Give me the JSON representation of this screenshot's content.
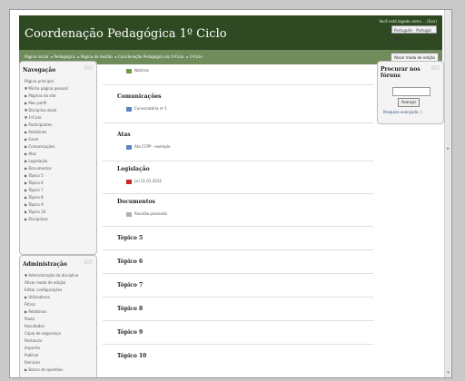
{
  "header": {
    "title": "Coordenação Pedagógica 1º Ciclo",
    "login_text": "Você está logado como ... (Sair)",
    "language": "Português - Portugal (pt)"
  },
  "navbar": {
    "breadcrumbs": [
      "Página inicial",
      "Pedagógica",
      "Página da Gestão",
      "Coordenação Pedagógica do 1ºCiclo",
      "1ºCiclo"
    ],
    "edit_button": "Ativar modo de edição"
  },
  "navigation": {
    "title": "Navegação",
    "items": [
      "Página principal",
      "▼ Minha página pessoal",
      "▶ Páginas do site",
      "▶ Meu perfil",
      "▼ Disciplina atual",
      "  ▼ 1ºCiclo",
      "    ▶ Participantes",
      "    ▶ Relatórios",
      "    ▶ Geral",
      "    ▶ Comunicações",
      "    ▶ Atas",
      "    ▶ Legislação",
      "    ▶ Documentos",
      "    ▶ Tópico 5",
      "    ▶ Tópico 6",
      "    ▶ Tópico 7",
      "    ▶ Tópico 8",
      "    ▶ Tópico 9",
      "    ▶ Tópico 10",
      "▶ Disciplinas"
    ]
  },
  "administration": {
    "title": "Administração",
    "items": [
      "▼ Administração da disciplina",
      "  Ativar modo de edição",
      "  Editar configurações",
      "▶ Utilizadores",
      "  Filtros",
      "▶ Relatórios",
      "  Pauta",
      "  Resultados",
      "  Cópia de segurança",
      "  Restaurar",
      "  Importar",
      "  Publicar",
      "  Reiniciar",
      "▶ Banco de questões"
    ]
  },
  "search": {
    "title": "Procurar nos fóruns",
    "button": "Avançar",
    "advanced_link": "Pesquisa avançada"
  },
  "main": {
    "top_activity": "Notícias",
    "sections": [
      {
        "heading": "Comunicações",
        "activity": "Convocatória nº 1"
      },
      {
        "heading": "Atas",
        "activity": "Ata CCPP - exemplo"
      },
      {
        "heading": "Legislação",
        "activity": "Lei 11.01.2012"
      },
      {
        "heading": "Documentos",
        "activity": "Reunião planeada"
      },
      {
        "heading": "Tópico 5"
      },
      {
        "heading": "Tópico 6"
      },
      {
        "heading": "Tópico 7"
      },
      {
        "heading": "Tópico 8"
      },
      {
        "heading": "Tópico 9"
      },
      {
        "heading": "Tópico 10"
      }
    ]
  },
  "colors": {
    "header": "#2f4a22",
    "navbar": "#6f8c5a"
  }
}
